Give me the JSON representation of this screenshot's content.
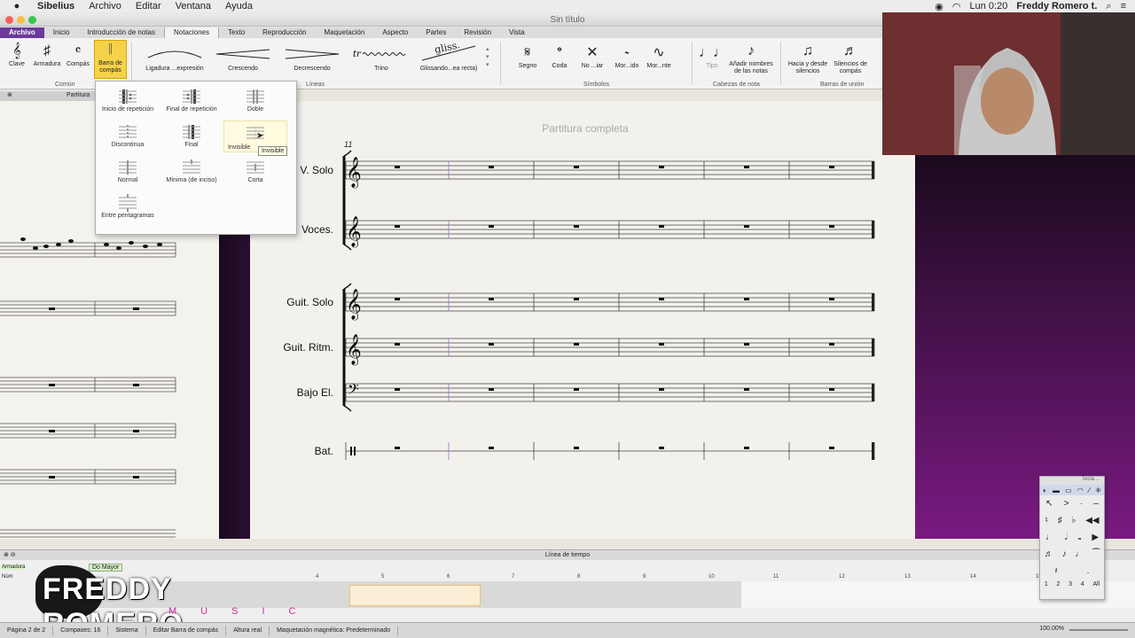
{
  "menubar": {
    "app": "Sibelius",
    "items": [
      "Archivo",
      "Editar",
      "Ventana",
      "Ayuda"
    ],
    "clock": "Lun 0:20",
    "user": "Freddy Romero t."
  },
  "window": {
    "title": "Sin título"
  },
  "ribbon": {
    "tabs": [
      "Archivo",
      "Inicio",
      "Introducción de notas",
      "Notaciones",
      "Texto",
      "Reproducción",
      "Maquetación",
      "Aspecto",
      "Partes",
      "Revisión",
      "Vista"
    ],
    "active_tab": "Notaciones",
    "common": {
      "label": "Común",
      "buttons": [
        "Clave",
        "Armadura",
        "Compás",
        "Barra de compás"
      ]
    },
    "lines": {
      "label": "Líneas",
      "items": [
        "Ligadura ...expresión",
        "Crescendo",
        "Decrescendo",
        "Trino",
        "Glissando...ea recta)"
      ],
      "gliss_text": "gliss."
    },
    "symbols": {
      "label": "Símbolos",
      "items": [
        "Segno",
        "Coda",
        "No ...iar",
        "Mor...ido",
        "Mor...nte"
      ]
    },
    "noteheads": {
      "label": "Cabezas de nota",
      "items": [
        "Tipo",
        "Añadir nombres de las notas"
      ]
    },
    "beams": {
      "label": "Barras de unión",
      "items": [
        "Hacia y desde silencios",
        "Silencios de compás"
      ]
    }
  },
  "barline_menu": {
    "items": [
      "Inicio de repetición",
      "Final de repetición",
      "Doble",
      "Discontinua",
      "Final",
      "Invisible",
      "Normal",
      "Mínima (de inciso)",
      "Corta",
      "Entre pentagramas"
    ],
    "tooltip": "Invisible"
  },
  "left_pane": {
    "label": "Partitura"
  },
  "score": {
    "title": "Partitura completa",
    "measure_number": "11",
    "instruments": [
      "V. Solo",
      "Voces.",
      "Guit. Solo",
      "Guit. Ritm.",
      "Bajo El.",
      "Bat."
    ]
  },
  "timeline": {
    "header": "Línea de tiempo",
    "row_labels": [
      "Armadura",
      "Núm"
    ],
    "key_signature": "Do Mayor",
    "bar_numbers": [
      "4",
      "5",
      "6",
      "7",
      "8",
      "9",
      "10",
      "11",
      "12",
      "13",
      "14",
      "15"
    ]
  },
  "keypad": {
    "title": "Tecla...",
    "tabs": [
      "1",
      "2",
      "3",
      "4",
      "All"
    ]
  },
  "logo": {
    "name": "FREDDY ROMERO",
    "sub": "MUSIC"
  },
  "statusbar": {
    "items": [
      "Página 2 de 2",
      "Compases: 16",
      "Sistema",
      "Editar Barra de compás",
      "Altura real",
      "Maquetación magnética: Predeterminado"
    ],
    "zoom": "100.00%"
  },
  "colors": {
    "accent": "#6b3a9a",
    "highlight": "#f6d24a",
    "purple": "#7a1a82"
  }
}
